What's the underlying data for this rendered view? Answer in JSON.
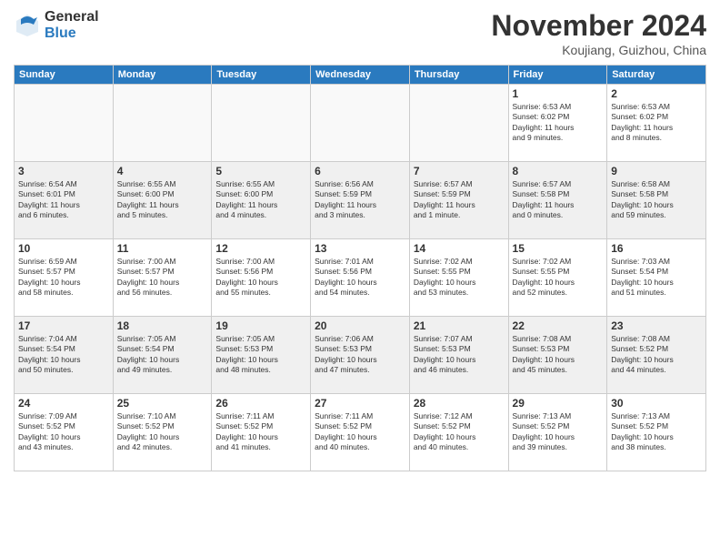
{
  "logo": {
    "general": "General",
    "blue": "Blue"
  },
  "header": {
    "month": "November 2024",
    "location": "Koujiang, Guizhou, China"
  },
  "days_of_week": [
    "Sunday",
    "Monday",
    "Tuesday",
    "Wednesday",
    "Thursday",
    "Friday",
    "Saturday"
  ],
  "weeks": [
    {
      "row_class": "odd",
      "days": [
        {
          "date": "",
          "content": "",
          "empty": true
        },
        {
          "date": "",
          "content": "",
          "empty": true
        },
        {
          "date": "",
          "content": "",
          "empty": true
        },
        {
          "date": "",
          "content": "",
          "empty": true
        },
        {
          "date": "",
          "content": "",
          "empty": true
        },
        {
          "date": "1",
          "content": "Sunrise: 6:53 AM\nSunset: 6:02 PM\nDaylight: 11 hours\nand 9 minutes.",
          "empty": false
        },
        {
          "date": "2",
          "content": "Sunrise: 6:53 AM\nSunset: 6:02 PM\nDaylight: 11 hours\nand 8 minutes.",
          "empty": false
        }
      ]
    },
    {
      "row_class": "even",
      "days": [
        {
          "date": "3",
          "content": "Sunrise: 6:54 AM\nSunset: 6:01 PM\nDaylight: 11 hours\nand 6 minutes.",
          "empty": false
        },
        {
          "date": "4",
          "content": "Sunrise: 6:55 AM\nSunset: 6:00 PM\nDaylight: 11 hours\nand 5 minutes.",
          "empty": false
        },
        {
          "date": "5",
          "content": "Sunrise: 6:55 AM\nSunset: 6:00 PM\nDaylight: 11 hours\nand 4 minutes.",
          "empty": false
        },
        {
          "date": "6",
          "content": "Sunrise: 6:56 AM\nSunset: 5:59 PM\nDaylight: 11 hours\nand 3 minutes.",
          "empty": false
        },
        {
          "date": "7",
          "content": "Sunrise: 6:57 AM\nSunset: 5:59 PM\nDaylight: 11 hours\nand 1 minute.",
          "empty": false
        },
        {
          "date": "8",
          "content": "Sunrise: 6:57 AM\nSunset: 5:58 PM\nDaylight: 11 hours\nand 0 minutes.",
          "empty": false
        },
        {
          "date": "9",
          "content": "Sunrise: 6:58 AM\nSunset: 5:58 PM\nDaylight: 10 hours\nand 59 minutes.",
          "empty": false
        }
      ]
    },
    {
      "row_class": "odd",
      "days": [
        {
          "date": "10",
          "content": "Sunrise: 6:59 AM\nSunset: 5:57 PM\nDaylight: 10 hours\nand 58 minutes.",
          "empty": false
        },
        {
          "date": "11",
          "content": "Sunrise: 7:00 AM\nSunset: 5:57 PM\nDaylight: 10 hours\nand 56 minutes.",
          "empty": false
        },
        {
          "date": "12",
          "content": "Sunrise: 7:00 AM\nSunset: 5:56 PM\nDaylight: 10 hours\nand 55 minutes.",
          "empty": false
        },
        {
          "date": "13",
          "content": "Sunrise: 7:01 AM\nSunset: 5:56 PM\nDaylight: 10 hours\nand 54 minutes.",
          "empty": false
        },
        {
          "date": "14",
          "content": "Sunrise: 7:02 AM\nSunset: 5:55 PM\nDaylight: 10 hours\nand 53 minutes.",
          "empty": false
        },
        {
          "date": "15",
          "content": "Sunrise: 7:02 AM\nSunset: 5:55 PM\nDaylight: 10 hours\nand 52 minutes.",
          "empty": false
        },
        {
          "date": "16",
          "content": "Sunrise: 7:03 AM\nSunset: 5:54 PM\nDaylight: 10 hours\nand 51 minutes.",
          "empty": false
        }
      ]
    },
    {
      "row_class": "even",
      "days": [
        {
          "date": "17",
          "content": "Sunrise: 7:04 AM\nSunset: 5:54 PM\nDaylight: 10 hours\nand 50 minutes.",
          "empty": false
        },
        {
          "date": "18",
          "content": "Sunrise: 7:05 AM\nSunset: 5:54 PM\nDaylight: 10 hours\nand 49 minutes.",
          "empty": false
        },
        {
          "date": "19",
          "content": "Sunrise: 7:05 AM\nSunset: 5:53 PM\nDaylight: 10 hours\nand 48 minutes.",
          "empty": false
        },
        {
          "date": "20",
          "content": "Sunrise: 7:06 AM\nSunset: 5:53 PM\nDaylight: 10 hours\nand 47 minutes.",
          "empty": false
        },
        {
          "date": "21",
          "content": "Sunrise: 7:07 AM\nSunset: 5:53 PM\nDaylight: 10 hours\nand 46 minutes.",
          "empty": false
        },
        {
          "date": "22",
          "content": "Sunrise: 7:08 AM\nSunset: 5:53 PM\nDaylight: 10 hours\nand 45 minutes.",
          "empty": false
        },
        {
          "date": "23",
          "content": "Sunrise: 7:08 AM\nSunset: 5:52 PM\nDaylight: 10 hours\nand 44 minutes.",
          "empty": false
        }
      ]
    },
    {
      "row_class": "odd",
      "days": [
        {
          "date": "24",
          "content": "Sunrise: 7:09 AM\nSunset: 5:52 PM\nDaylight: 10 hours\nand 43 minutes.",
          "empty": false
        },
        {
          "date": "25",
          "content": "Sunrise: 7:10 AM\nSunset: 5:52 PM\nDaylight: 10 hours\nand 42 minutes.",
          "empty": false
        },
        {
          "date": "26",
          "content": "Sunrise: 7:11 AM\nSunset: 5:52 PM\nDaylight: 10 hours\nand 41 minutes.",
          "empty": false
        },
        {
          "date": "27",
          "content": "Sunrise: 7:11 AM\nSunset: 5:52 PM\nDaylight: 10 hours\nand 40 minutes.",
          "empty": false
        },
        {
          "date": "28",
          "content": "Sunrise: 7:12 AM\nSunset: 5:52 PM\nDaylight: 10 hours\nand 40 minutes.",
          "empty": false
        },
        {
          "date": "29",
          "content": "Sunrise: 7:13 AM\nSunset: 5:52 PM\nDaylight: 10 hours\nand 39 minutes.",
          "empty": false
        },
        {
          "date": "30",
          "content": "Sunrise: 7:13 AM\nSunset: 5:52 PM\nDaylight: 10 hours\nand 38 minutes.",
          "empty": false
        }
      ]
    }
  ]
}
